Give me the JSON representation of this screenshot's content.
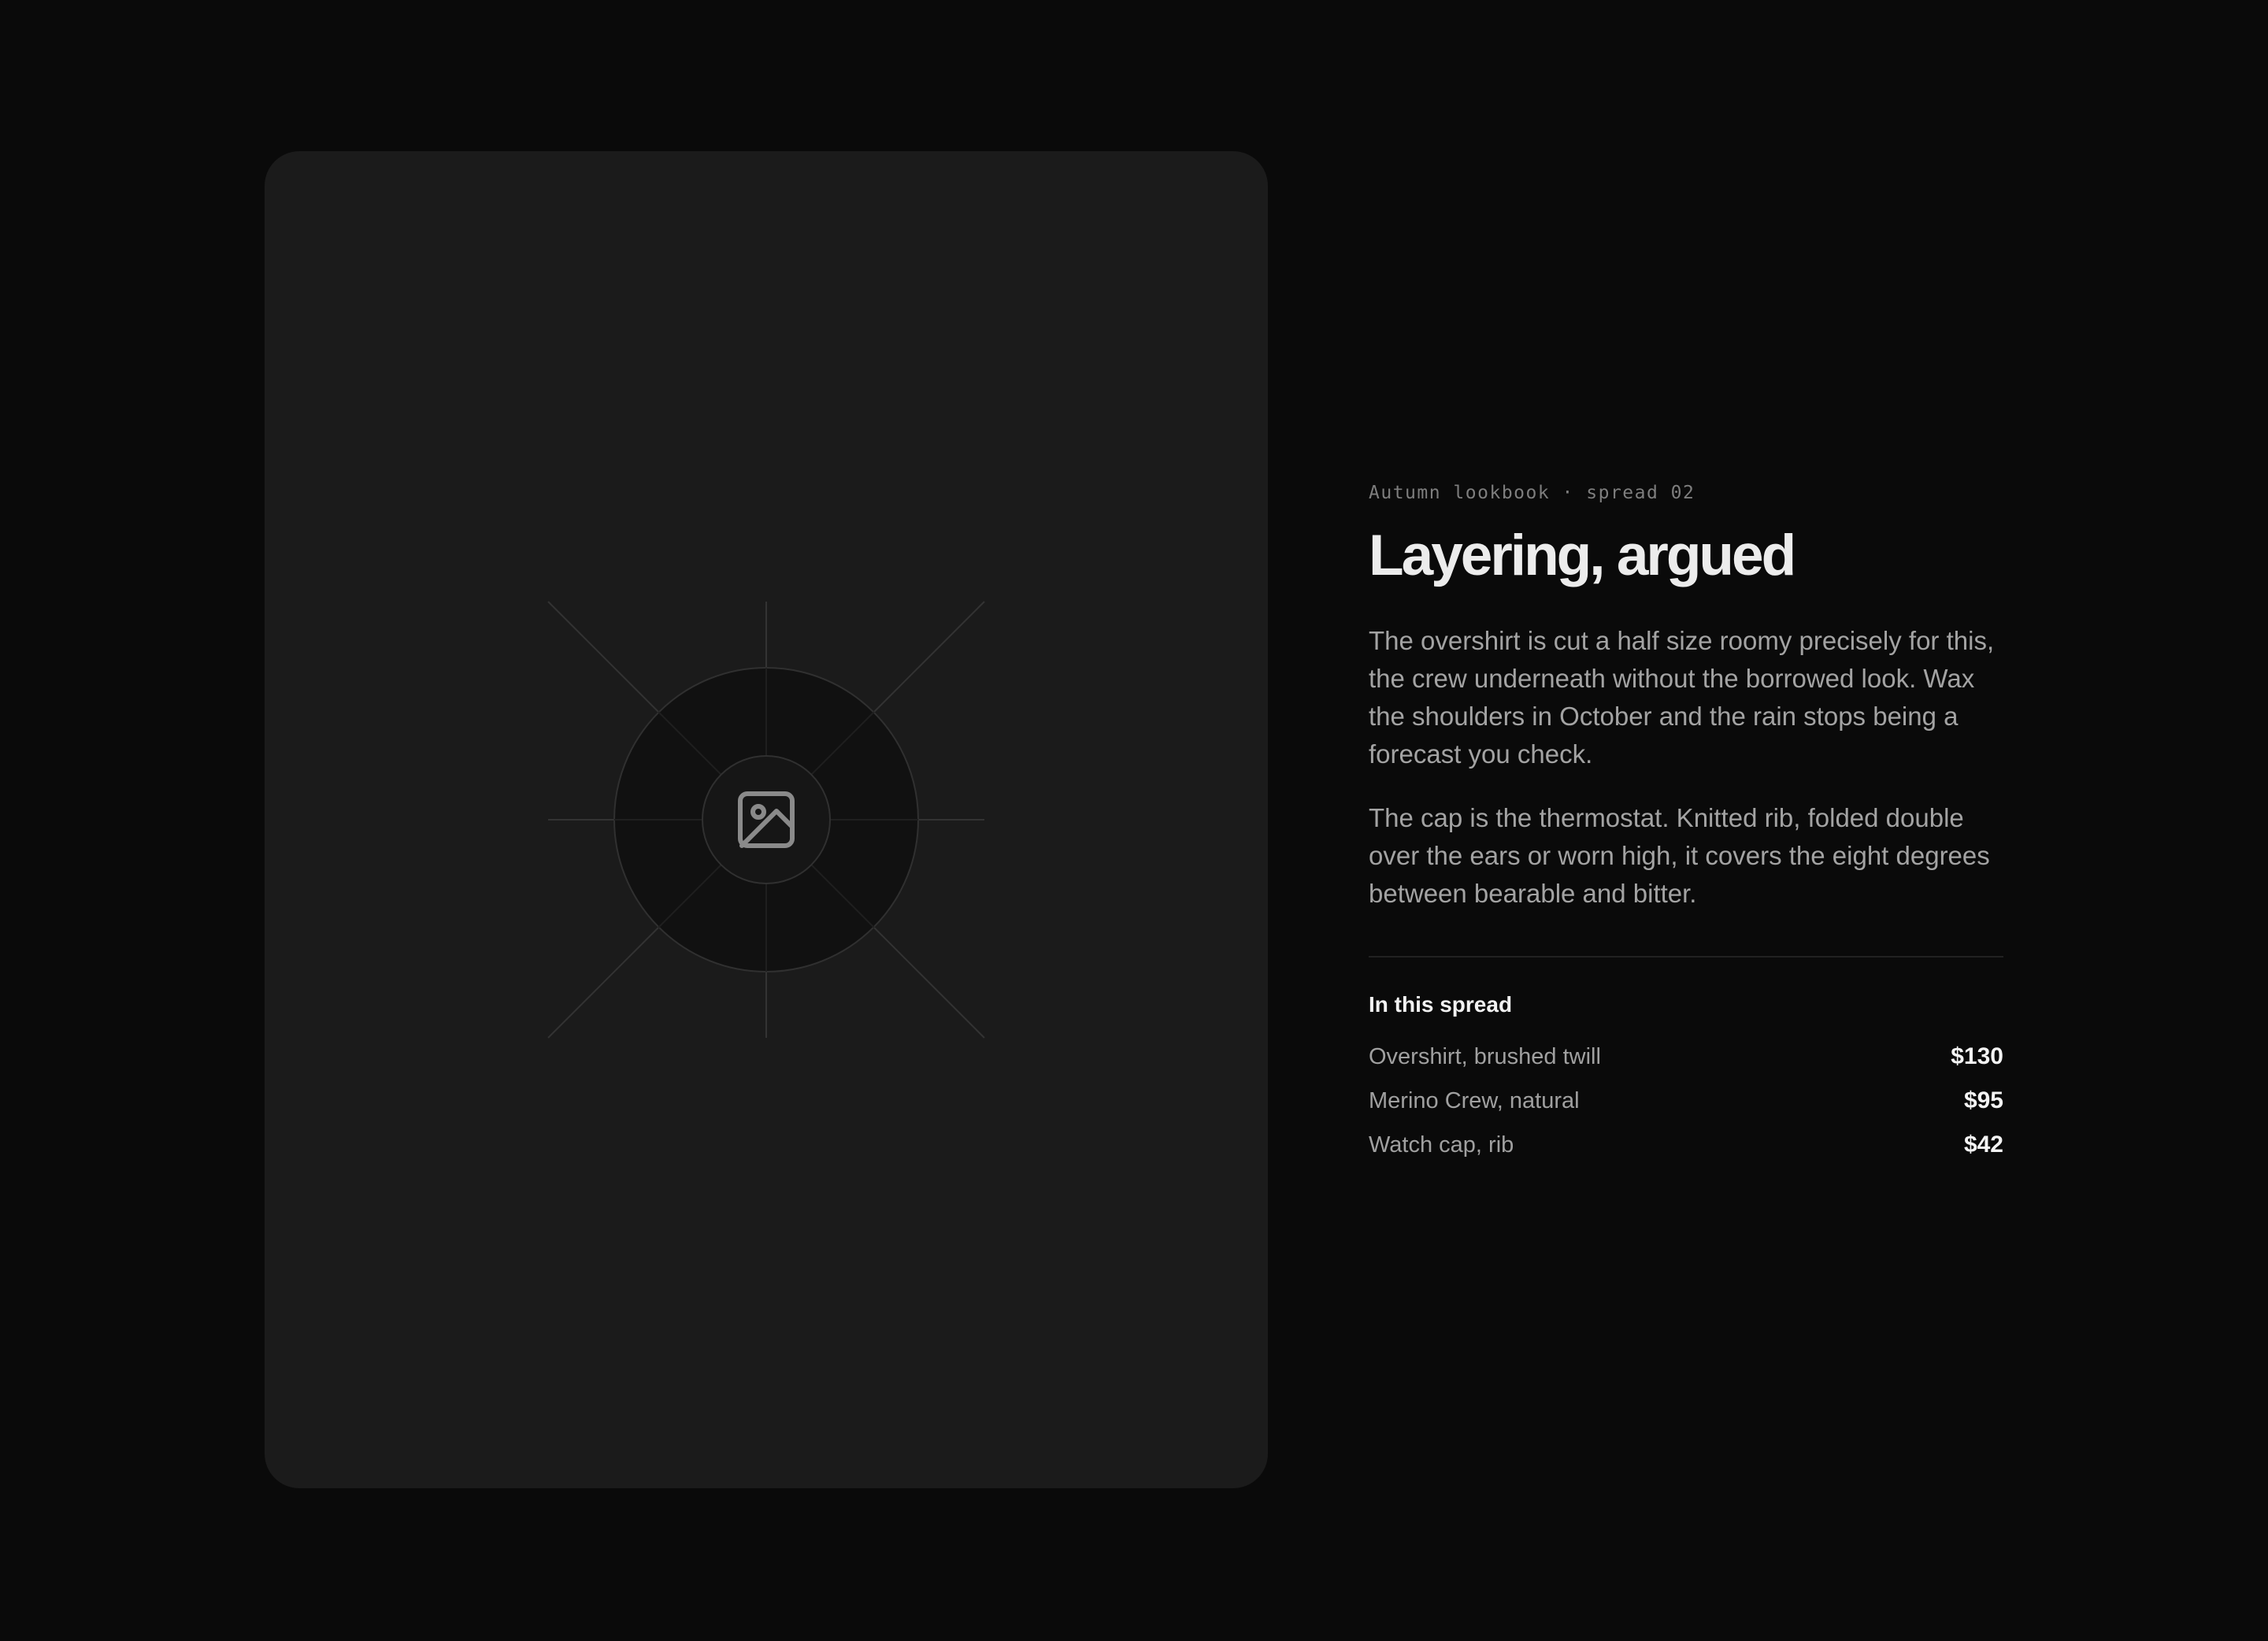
{
  "spread": {
    "eyebrow": "Autumn lookbook · spread 02",
    "title": "Layering, argued",
    "paragraphs": [
      "The overshirt is cut a half size roomy precisely for this, the crew underneath without the borrowed look. Wax the shoulders in October and the rain stops being a forecast you check.",
      "The cap is the thermostat. Knitted rib, folded double over the ears or worn high, it covers the eight degrees between bearable and bitter."
    ]
  },
  "in_this_spread": {
    "heading": "In this spread",
    "items": [
      {
        "name": "Overshirt, brushed twill",
        "price": "$130"
      },
      {
        "name": "Merino Crew, natural",
        "price": "$95"
      },
      {
        "name": "Watch cap, rib",
        "price": "$42"
      }
    ]
  },
  "image": {
    "icon": "image-icon"
  },
  "colors": {
    "page_background": "#0a0a0a",
    "card_background": "#1b1b1b",
    "title": "#ececec",
    "body_text": "#a3a3a3",
    "muted_text": "#7e7e7e",
    "price_text": "#f4f4f4"
  }
}
